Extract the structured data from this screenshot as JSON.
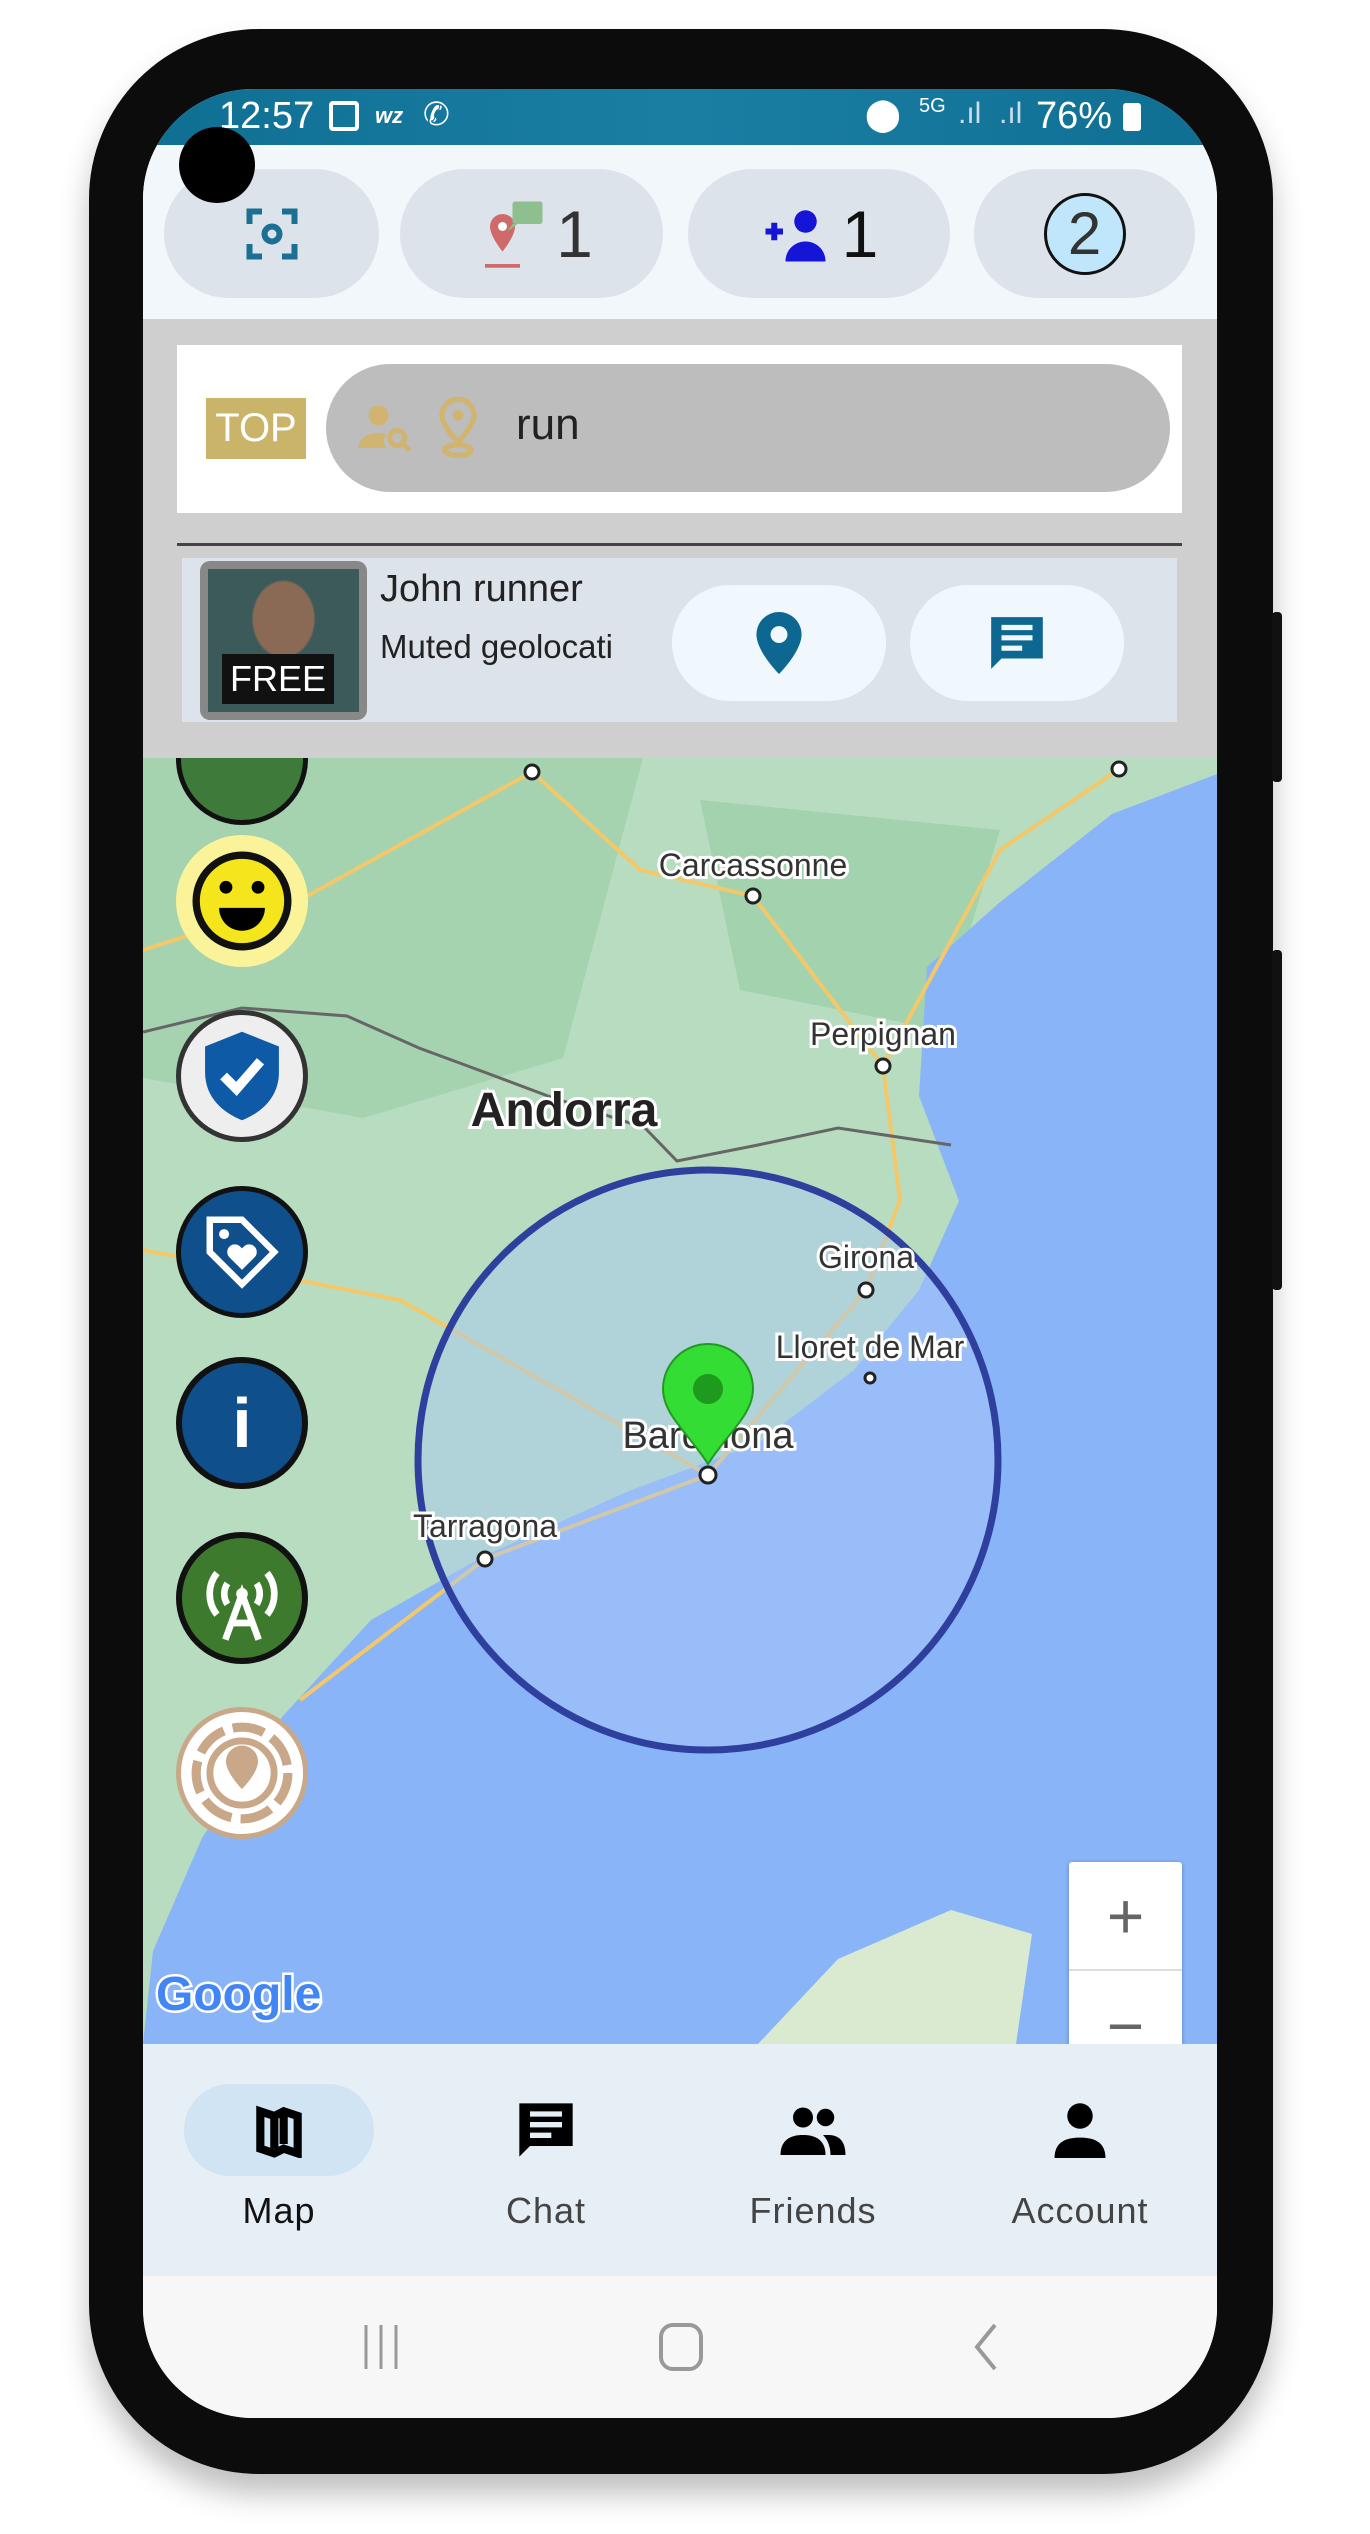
{
  "status_bar": {
    "time": "12:57",
    "network": "5G",
    "battery": "76%",
    "icons": [
      "gallery-icon",
      "wizz-icon",
      "wifi-call-icon",
      "location-icon",
      "signal-icon",
      "signal-icon",
      "battery-charging-icon"
    ]
  },
  "header": {
    "buttons": [
      {
        "name": "scan",
        "icon": "scan-target-icon"
      },
      {
        "name": "location-messages",
        "icon": "pin-message-icon",
        "count": "1"
      },
      {
        "name": "friend-requests",
        "icon": "add-person-icon",
        "count": "1"
      },
      {
        "name": "counter",
        "value": "2"
      }
    ]
  },
  "search": {
    "badge": "TOP",
    "query": "run",
    "icons": [
      "person-search-icon",
      "location-pin-icon"
    ]
  },
  "result": {
    "name": "John runner",
    "subtitle": "Muted geolocati",
    "avatar_badge": "FREE"
  },
  "map": {
    "places": [
      "Carcassonne",
      "Perpignan",
      "Andorra",
      "Girona",
      "Lloret de Mar",
      "Barcelona",
      "Tarragona"
    ],
    "attribution": "Google",
    "zoom_in": "+",
    "zoom_out": "−",
    "side_buttons": [
      "smiley-icon",
      "shield-check-icon",
      "tag-heart-icon",
      "info-icon",
      "antenna-icon",
      "location-target-icon"
    ],
    "colors": {
      "sea": "#8ab4f8",
      "radius": "#2f3f9e",
      "pin": "#33dd33"
    }
  },
  "bottom_nav": {
    "items": [
      {
        "label": "Map",
        "active": true
      },
      {
        "label": "Chat"
      },
      {
        "label": "Friends"
      },
      {
        "label": "Account"
      }
    ]
  }
}
